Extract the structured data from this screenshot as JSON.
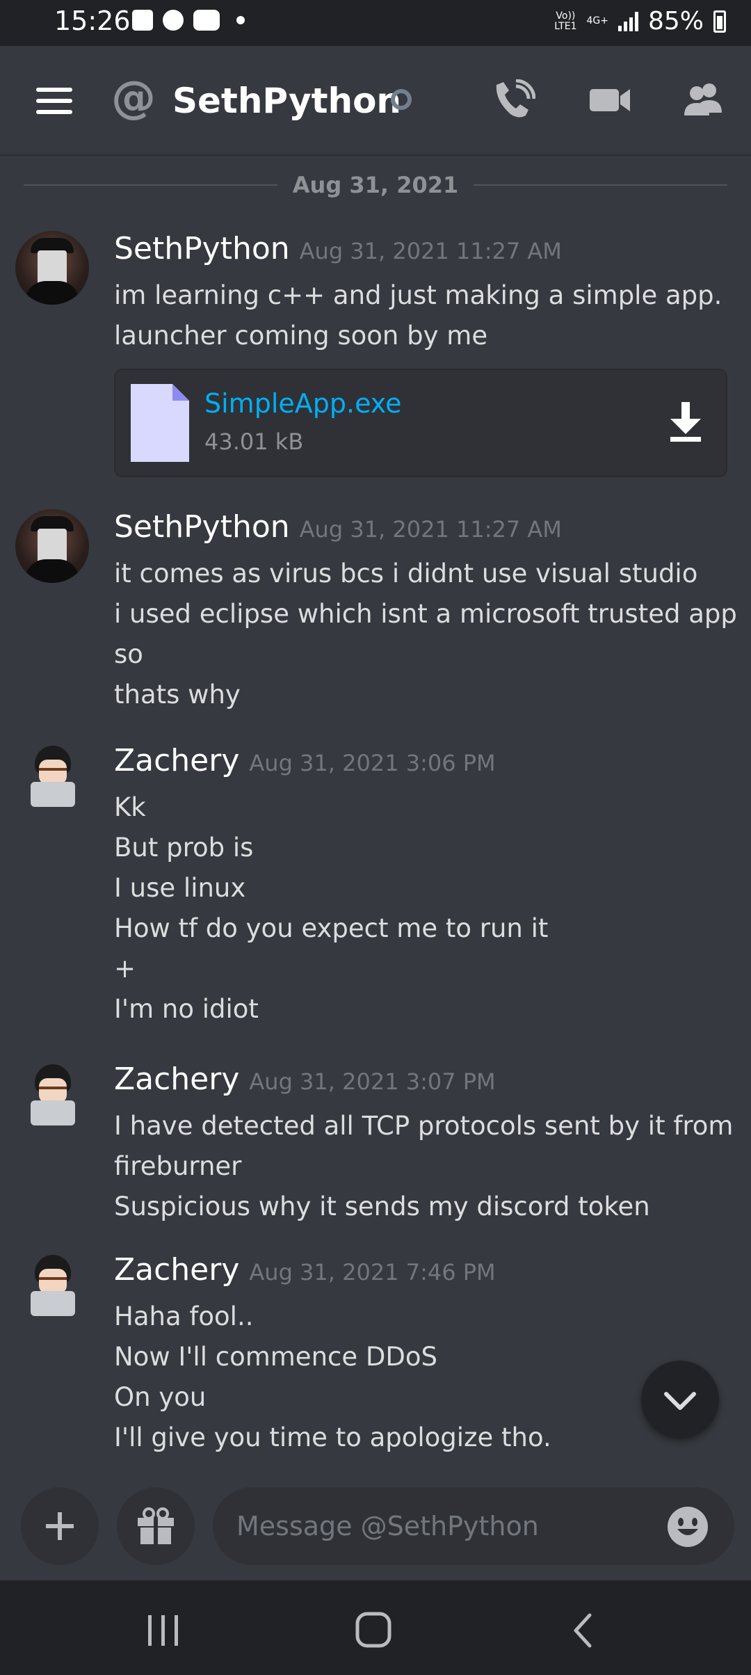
{
  "status_bar": {
    "time": "15:26",
    "network_top": "Vo))",
    "network_bottom": "LTE1",
    "network_type": "4G+",
    "battery": "85%"
  },
  "header": {
    "channel_icon": "at-icon",
    "at_symbol": "@",
    "channel_name": "SethPython",
    "presence": "offline"
  },
  "messages": {
    "date_divider": "Aug 31, 2021",
    "groups": [
      {
        "author": "SethPython",
        "timestamp": "Aug 31, 2021 11:27 AM",
        "lines": [
          "im learning c++ and just making a simple app.",
          "launcher coming soon by me"
        ],
        "attachment": {
          "name": "SimpleApp.exe",
          "size": "43.01 kB"
        }
      },
      {
        "author": "SethPython",
        "timestamp": "Aug 31, 2021 11:27 AM",
        "lines": [
          "it comes as virus bcs i didnt use visual studio",
          "i used eclipse which isnt a microsoft trusted app",
          "so",
          "thats why"
        ]
      },
      {
        "author": "Zachery",
        "timestamp": "Aug 31, 2021 3:06 PM",
        "lines": [
          "Kk",
          "But prob is",
          "I use linux",
          "How tf do you expect me to run it",
          "+",
          "I'm no idiot"
        ]
      },
      {
        "author": "Zachery",
        "timestamp": "Aug 31, 2021 3:07 PM",
        "lines": [
          "I have detected all TCP protocols sent by it from",
          "fireburner",
          "Suspicious why it sends my discord token"
        ]
      },
      {
        "author": "Zachery",
        "timestamp": "Aug 31, 2021 7:46 PM",
        "lines": [
          "Haha fool..",
          "Now I'll commence DDoS",
          "On you",
          "I'll give you time to apologize tho."
        ]
      }
    ]
  },
  "composer": {
    "placeholder": "Message @SethPython",
    "value": ""
  },
  "colors": {
    "background": "#36393f",
    "link": "#00aff4",
    "timestamp": "#72767d"
  }
}
